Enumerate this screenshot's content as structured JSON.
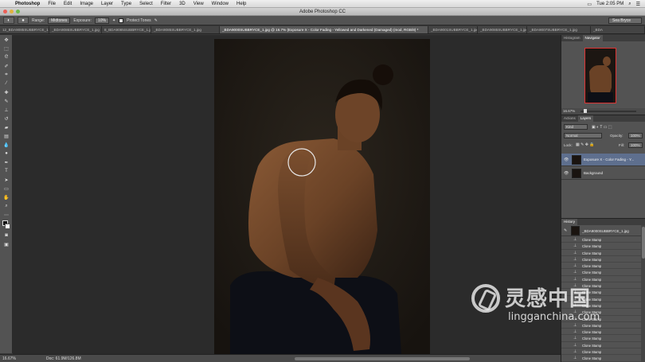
{
  "menubar": {
    "items": [
      "Photoshop",
      "File",
      "Edit",
      "Image",
      "Layer",
      "Type",
      "Select",
      "Filter",
      "3D",
      "View",
      "Window",
      "Help"
    ],
    "clock": "Tue 2:05 PM"
  },
  "window": {
    "title": "Adobe Photoshop CC"
  },
  "options": {
    "range_label": "Range:",
    "range_value": "Midtones",
    "exposure_label": "Exposure:",
    "exposure_value": "10%",
    "protect_label": "Protect Tones",
    "workspace": "Sea Bryce"
  },
  "tabs": [
    "12_BDA9085SUBBRYCE_1.jpg",
    "_BDA9086SUBBRYCE_1.jpg",
    "8_BDA9085SUBBRYCE_1.jpg",
    "_BDA9085SUBBRYCE_1.jpg",
    "_BDA9000SUBBRYCE_1.jpg @ 16.7% (Exposure X - Color Fading - Yellowed and Darkened (Damaged) (mod, RGB/8) *",
    "_BDA9001SUBBRYCE_1.jpg",
    "_BDA9085SUBBRYCE_1.jpg",
    "_BDA9007SUBBRYCE_1.jpg",
    "_BDA"
  ],
  "active_tab_index": 4,
  "status": {
    "zoom": "16.67%",
    "doc": "Doc: 61.9M/126.8M"
  },
  "navigator": {
    "tabs": [
      "Histogram",
      "Navigator"
    ],
    "zoom": "16.67%"
  },
  "layers": {
    "tabs": [
      "Actions",
      "Layers"
    ],
    "kind": "Kind",
    "blend_mode": "Normal",
    "opacity_label": "Opacity:",
    "opacity_value": "100%",
    "lock_label": "Lock:",
    "fill_label": "Fill:",
    "fill_value": "100%",
    "items": [
      {
        "name": "Exposure X - Color Fading - Y...",
        "selected": true
      },
      {
        "name": "Background",
        "selected": false
      }
    ]
  },
  "history": {
    "tab": "History",
    "snapshot": "_BDA9000SUBBRYCE_1.jpg",
    "items": [
      "Clone Stamp",
      "Clone Stamp",
      "Clone Stamp",
      "Clone Stamp",
      "Clone Stamp",
      "Clone Stamp",
      "Clone Stamp",
      "Clone Stamp",
      "Clone Stamp",
      "Clone Stamp",
      "Clone Stamp",
      "Clone Stamp",
      "Clone Stamp",
      "Clone Stamp",
      "Clone Stamp",
      "Clone Stamp",
      "Clone Stamp",
      "Clone Stamp",
      "Clone Stamp"
    ]
  },
  "watermark": {
    "cn": "灵感中国",
    "en": "lingganchina.com"
  },
  "colors": {
    "panel": "#535353",
    "canvas": "#2b2b2b",
    "selected_layer": "#5e6f8e"
  }
}
